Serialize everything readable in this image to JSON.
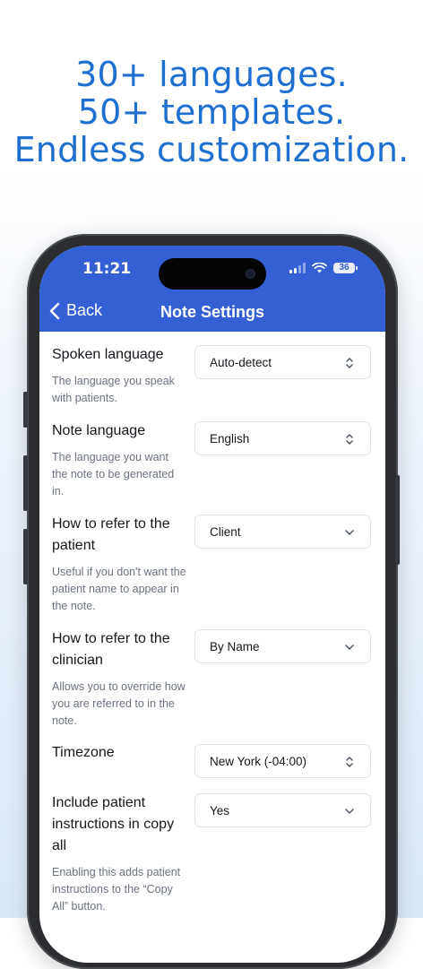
{
  "headline": {
    "line1": "30+ languages.",
    "line2": "50+ templates.",
    "line3": "Endless customization."
  },
  "status_bar": {
    "time": "11:21",
    "battery": "36"
  },
  "nav": {
    "back_label": "Back",
    "title": "Note Settings"
  },
  "colors": {
    "accent": "#3360d4",
    "headline": "#1f6fd0"
  },
  "settings": [
    {
      "label": "Spoken language",
      "description": "The language you speak with patients.",
      "value": "Auto-detect",
      "icon": "chevron-updown-icon"
    },
    {
      "label": "Note language",
      "description": "The language you want the note to be generated in.",
      "value": "English",
      "icon": "chevron-updown-icon"
    },
    {
      "label": "How to refer to the patient",
      "description": "Useful if you don't want the patient name to appear in the note.",
      "value": "Client",
      "icon": "chevron-down-icon"
    },
    {
      "label": "How to refer to the clinician",
      "description": "Allows you to override how you are referred to in the note.",
      "value": "By Name",
      "icon": "chevron-down-icon"
    },
    {
      "label": "Timezone",
      "description": "",
      "value": "New York (-04:00)",
      "icon": "chevron-updown-icon"
    },
    {
      "label": "Include patient instructions in copy all",
      "description": "Enabling this adds patient instructions to the “Copy All” button.",
      "value": "Yes",
      "icon": "chevron-down-icon"
    }
  ]
}
